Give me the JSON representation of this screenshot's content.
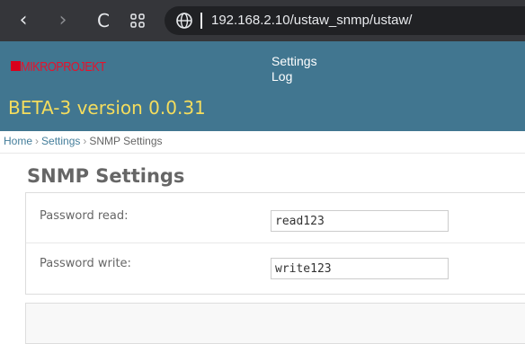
{
  "browser": {
    "back_icon": "‹",
    "forward_icon": "›",
    "reload_icon": "C",
    "tabs_icon": "88",
    "url": "192.168.2.10/ustaw_snmp/ustaw/"
  },
  "header": {
    "logo_text": "MIKROPROJEKT",
    "menu": [
      "Settings",
      "Log"
    ],
    "version": "BETA-3 version 0.0.31"
  },
  "breadcrumb": [
    "Home",
    "Settings",
    "SNMP Settings"
  ],
  "breadcrumb_separator": "›",
  "page": {
    "title": "SNMP Settings",
    "fields": [
      {
        "label": "Password read:",
        "value": "read123"
      },
      {
        "label": "Password write:",
        "value": "write123"
      }
    ]
  },
  "colors": {
    "header_bg": "#417690",
    "version_text": "#f5dd5d",
    "logo": "#e5122c",
    "link": "#447e9b"
  }
}
